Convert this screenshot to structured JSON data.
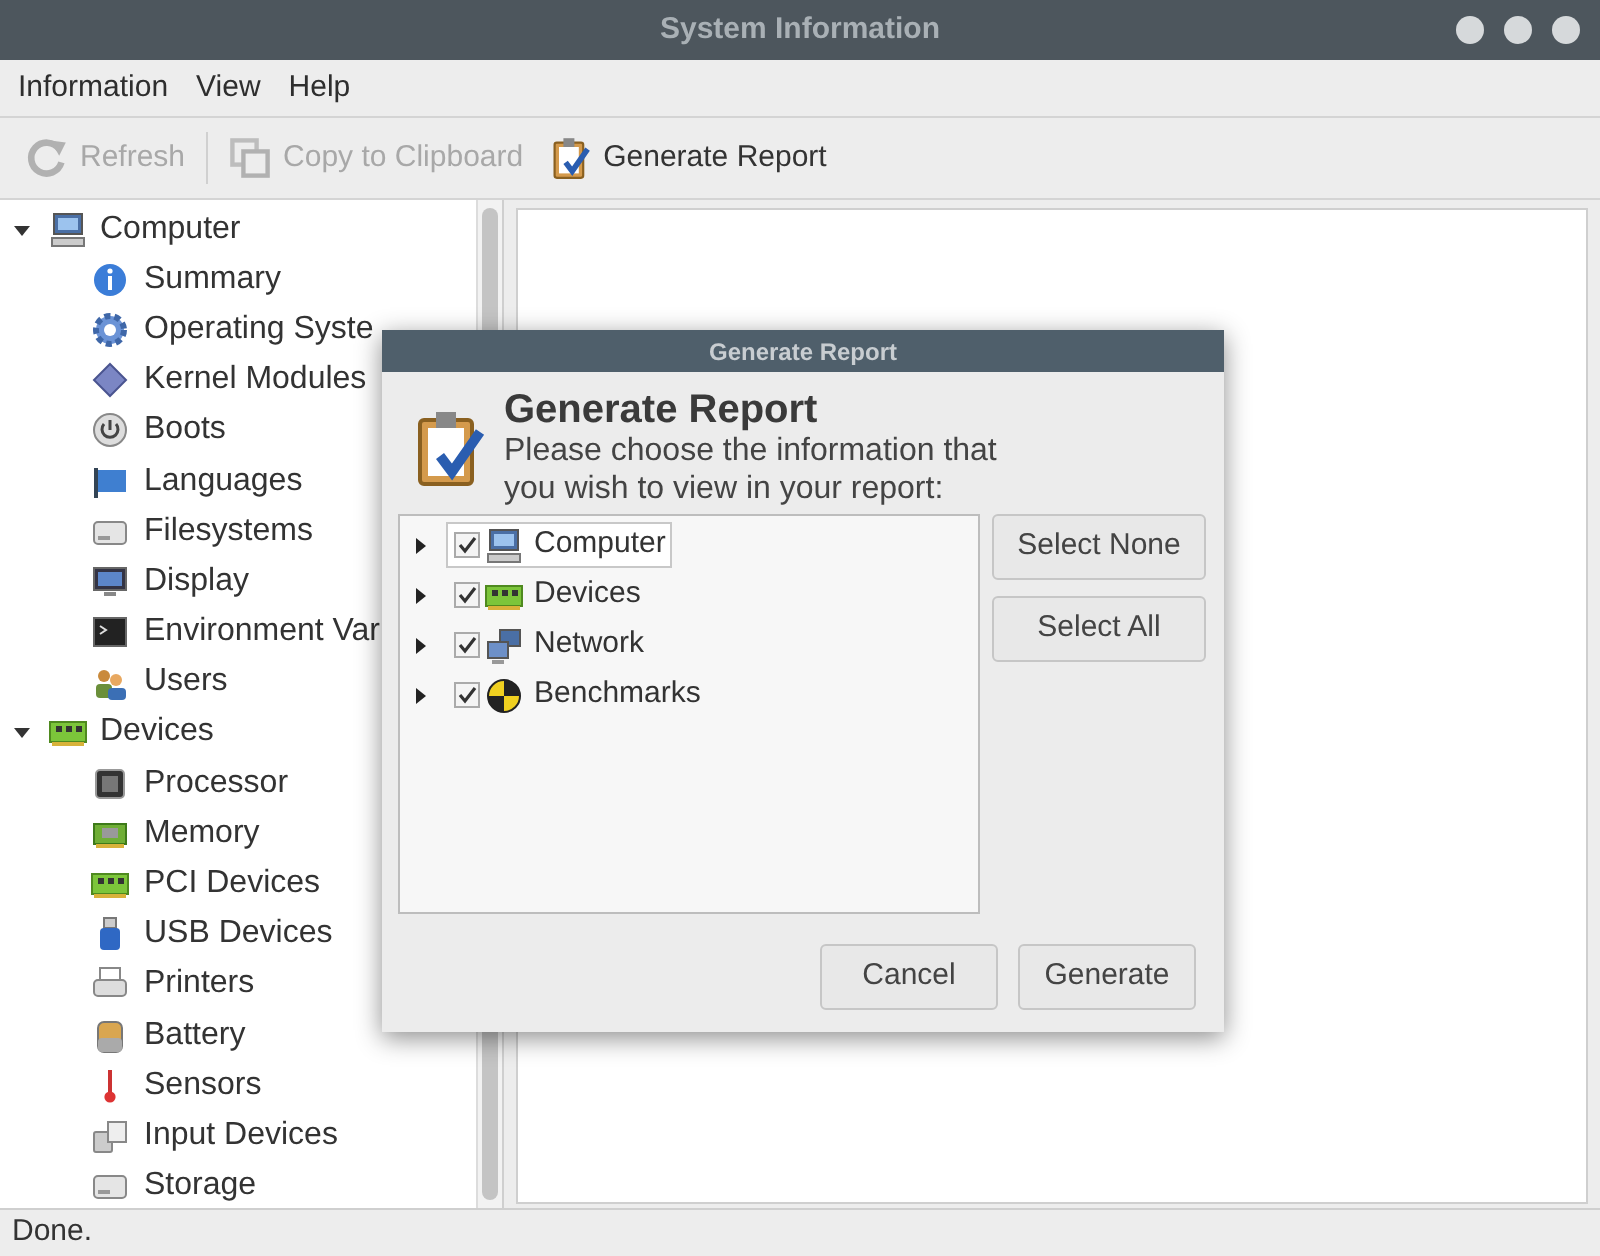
{
  "window": {
    "title": "System Information"
  },
  "menu": [
    "Information",
    "View",
    "Help"
  ],
  "toolbar": [
    {
      "label": "Refresh",
      "disabled": true
    },
    {
      "label": "Copy to Clipboard",
      "disabled": true
    },
    {
      "label": "Generate Report",
      "disabled": false
    }
  ],
  "sidebar": {
    "items": [
      {
        "label": "Computer",
        "expanded": true,
        "children": [
          {
            "label": "Summary"
          },
          {
            "label": "Operating Syste"
          },
          {
            "label": "Kernel Modules"
          },
          {
            "label": "Boots"
          },
          {
            "label": "Languages"
          },
          {
            "label": "Filesystems"
          },
          {
            "label": "Display"
          },
          {
            "label": "Environment Var"
          },
          {
            "label": "Users"
          }
        ]
      },
      {
        "label": "Devices",
        "expanded": true,
        "children": [
          {
            "label": "Processor"
          },
          {
            "label": "Memory"
          },
          {
            "label": "PCI Devices"
          },
          {
            "label": "USB Devices"
          },
          {
            "label": "Printers"
          },
          {
            "label": "Battery"
          },
          {
            "label": "Sensors"
          },
          {
            "label": "Input Devices"
          },
          {
            "label": "Storage"
          }
        ]
      }
    ]
  },
  "dialog": {
    "title": "Generate Report",
    "heading": "Generate Report",
    "description": "Please choose the information that you wish to view in your report:",
    "items": [
      {
        "label": "Computer",
        "checked": true,
        "expanded": false,
        "selected": true
      },
      {
        "label": "Devices",
        "checked": true,
        "expanded": false,
        "selected": false
      },
      {
        "label": "Network",
        "checked": true,
        "expanded": false,
        "selected": false
      },
      {
        "label": "Benchmarks",
        "checked": true,
        "expanded": false,
        "selected": false
      }
    ],
    "side_buttons": [
      "Select None",
      "Select All"
    ],
    "buttons": [
      "Cancel",
      "Generate"
    ]
  },
  "status_bar": "Done."
}
